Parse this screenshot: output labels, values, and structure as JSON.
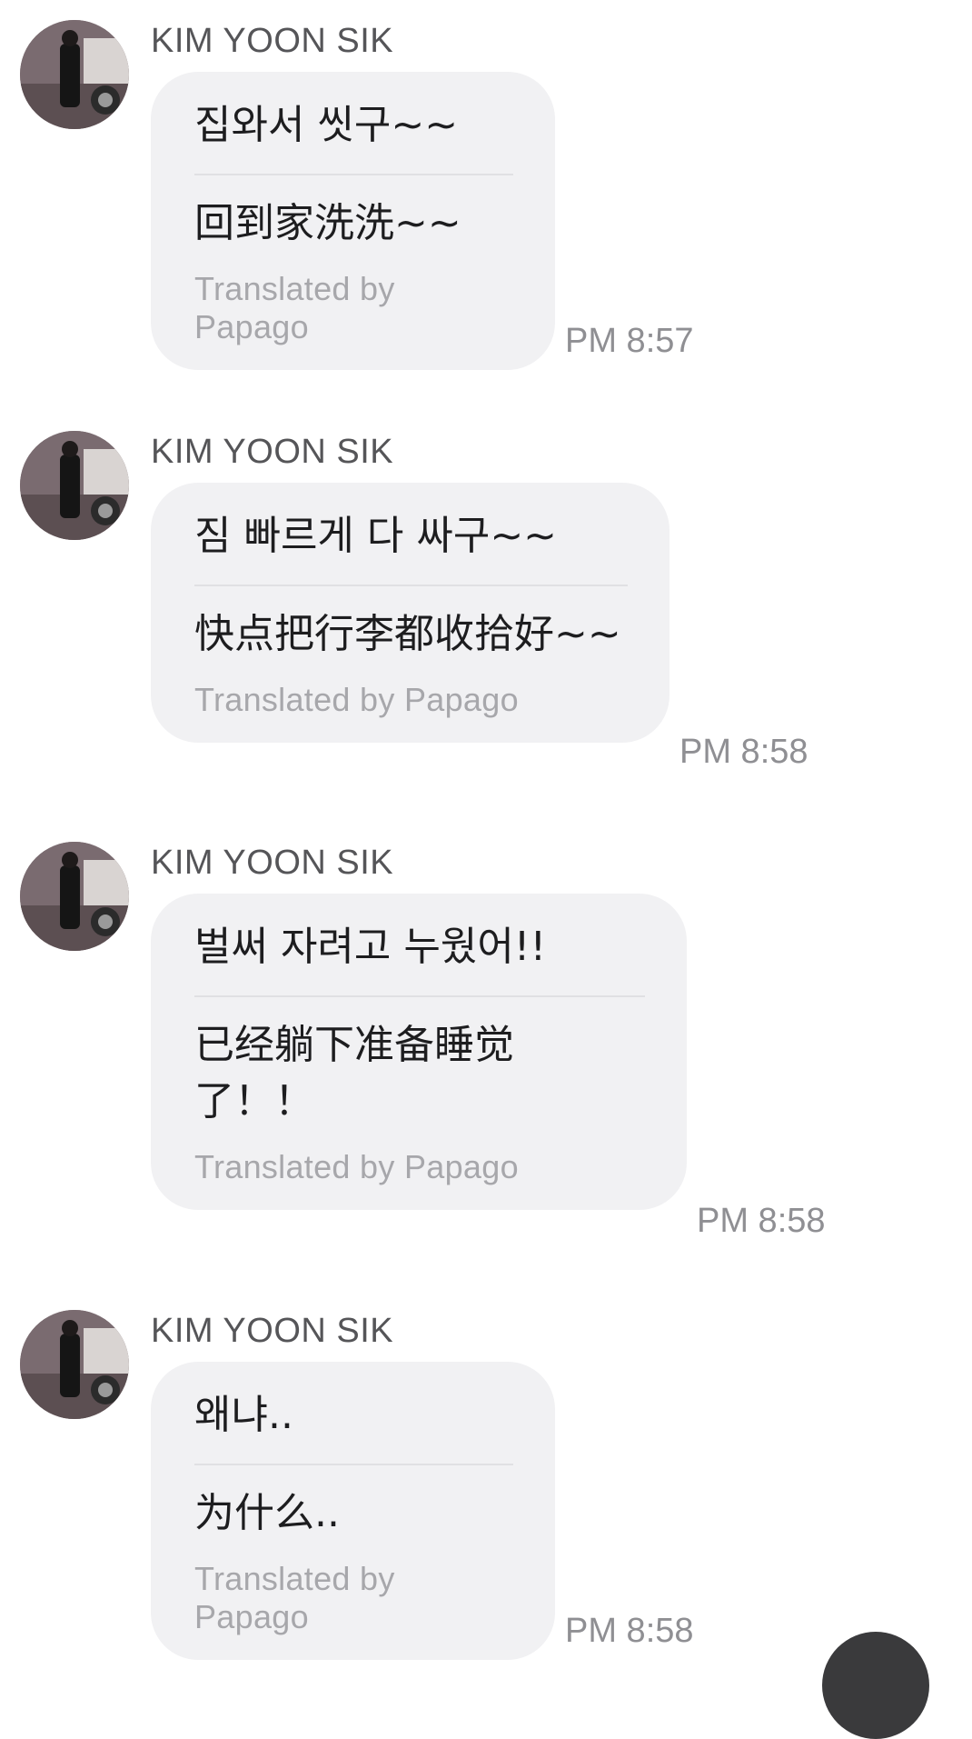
{
  "messages": [
    {
      "sender": "KIM YOON SIK",
      "original": "집와서 씻구~~",
      "translated": "回到家洗洗~~",
      "credit": "Translated by Papago",
      "time": "PM 8:57"
    },
    {
      "sender": "KIM YOON SIK",
      "original": "짐 빠르게 다 싸구~~",
      "translated": "快点把行李都收拾好~~",
      "credit": "Translated by Papago",
      "time": "PM 8:58"
    },
    {
      "sender": "KIM YOON SIK",
      "original": "벌써 자려고 누웠어!!",
      "translated": "已经躺下准备睡觉\n了！！",
      "credit": "Translated by Papago",
      "time": "PM 8:58"
    },
    {
      "sender": "KIM YOON SIK",
      "original": "왜냐..",
      "translated": "为什么..",
      "credit": "Translated by Papago",
      "time": "PM 8:58"
    }
  ],
  "icons": {
    "avatar": "profile-photo",
    "fab": "scroll-button"
  },
  "colors": {
    "bubble": "#f1f1f3",
    "credit": "#a7a7ab",
    "time": "#8f8f93",
    "fab": "#3a3a3c"
  }
}
